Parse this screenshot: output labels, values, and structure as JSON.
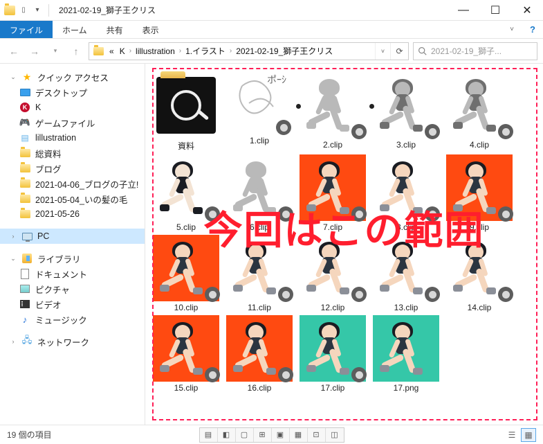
{
  "window": {
    "title": "2021-02-19_獅子王クリス",
    "controls": {
      "minimize": "—",
      "maximize": "☐",
      "close": "✕"
    }
  },
  "ribbon": {
    "file": "ファイル",
    "home": "ホーム",
    "share": "共有",
    "view": "表示"
  },
  "breadcrumb": {
    "prefix": "«",
    "parts": [
      "K",
      "lillustration",
      "1.イラスト",
      "2021-02-19_獅子王クリス"
    ]
  },
  "search": {
    "placeholder": "2021-02-19_獅子..."
  },
  "sidebar": {
    "quick": {
      "label": "クイック アクセス",
      "items": [
        {
          "icon": "desktop",
          "label": "デスクトップ"
        },
        {
          "icon": "k",
          "label": "K"
        },
        {
          "icon": "game",
          "label": "ゲームファイル"
        },
        {
          "icon": "lib",
          "label": "lillustration"
        },
        {
          "icon": "folder",
          "label": "総資料"
        },
        {
          "icon": "folder",
          "label": "ブログ"
        },
        {
          "icon": "folder",
          "label": "2021-04-06_ブログの子立!"
        },
        {
          "icon": "folder",
          "label": "2021-05-04_いの髪の毛"
        },
        {
          "icon": "folder",
          "label": "2021-05-26"
        }
      ]
    },
    "pc": {
      "label": "PC"
    },
    "libraries": {
      "label": "ライブラリ",
      "items": [
        {
          "icon": "doc",
          "label": "ドキュメント"
        },
        {
          "icon": "pic",
          "label": "ピクチャ"
        },
        {
          "icon": "vid",
          "label": "ビデオ"
        },
        {
          "icon": "mus",
          "label": "ミュージック"
        }
      ]
    },
    "network": {
      "label": "ネットワーク"
    }
  },
  "files": [
    {
      "name": "資料",
      "kind": "folder-dark"
    },
    {
      "name": "1.clip",
      "kind": "sketch-rough",
      "badge": true
    },
    {
      "name": "2.clip",
      "kind": "sketch-line",
      "badge": true,
      "dot": true
    },
    {
      "name": "3.clip",
      "kind": "sketch-gray",
      "badge": true,
      "dot": true
    },
    {
      "name": "4.clip",
      "kind": "sketch-gray",
      "badge": true
    },
    {
      "name": "5.clip",
      "kind": "fig-white-dark",
      "badge": true
    },
    {
      "name": "6.clip",
      "kind": "fig-white-line",
      "badge": true
    },
    {
      "name": "7.clip",
      "kind": "fig-orange",
      "badge": true
    },
    {
      "name": "8.clip",
      "kind": "fig-gray",
      "badge": true
    },
    {
      "name": "9.clip",
      "kind": "fig-orange",
      "badge": true
    },
    {
      "name": "10.clip",
      "kind": "fig-orange",
      "badge": true
    },
    {
      "name": "11.clip",
      "kind": "fig-white-color",
      "badge": true
    },
    {
      "name": "12.clip",
      "kind": "fig-white-color",
      "badge": true
    },
    {
      "name": "13.clip",
      "kind": "fig-white-color",
      "badge": true
    },
    {
      "name": "14.clip",
      "kind": "fig-white-color",
      "badge": true
    },
    {
      "name": "15.clip",
      "kind": "fig-orange",
      "badge": true
    },
    {
      "name": "16.clip",
      "kind": "fig-orange",
      "badge": true
    },
    {
      "name": "17.clip",
      "kind": "fig-teal",
      "badge": true
    },
    {
      "name": "17.png",
      "kind": "fig-teal",
      "badge": false
    }
  ],
  "overlay": "今回はこの範囲",
  "status": {
    "count": "19 個の項目"
  }
}
